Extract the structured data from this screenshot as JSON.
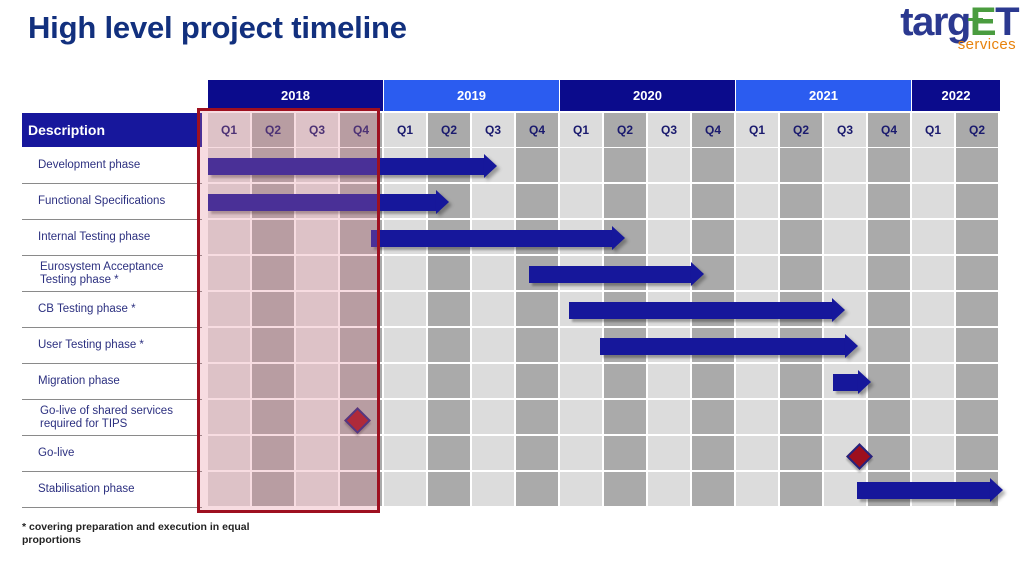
{
  "title": "High level project timeline",
  "logo": {
    "word_before": "targ",
    "word_euro": "E",
    "word_after": "T",
    "subtitle": "services"
  },
  "table": {
    "description_header": "Description",
    "years": [
      {
        "label": "2018",
        "quarters": 4,
        "tone": "dark"
      },
      {
        "label": "2019",
        "quarters": 4,
        "tone": "light"
      },
      {
        "label": "2020",
        "quarters": 4,
        "tone": "dark"
      },
      {
        "label": "2021",
        "quarters": 4,
        "tone": "light"
      },
      {
        "label": "2022",
        "quarters": 2,
        "tone": "dark"
      }
    ],
    "quarter_labels": [
      "Q1",
      "Q2",
      "Q3",
      "Q4",
      "Q1",
      "Q2",
      "Q3",
      "Q4",
      "Q1",
      "Q2",
      "Q3",
      "Q4",
      "Q1",
      "Q2",
      "Q3",
      "Q4",
      "Q1",
      "Q2"
    ],
    "rows": [
      {
        "label": "Development phase",
        "type": "bar",
        "start_q": 0.0,
        "end_q": 6.3
      },
      {
        "label": "Functional Specifications",
        "type": "bar",
        "start_q": 0.0,
        "end_q": 5.2
      },
      {
        "label": "Internal Testing phase",
        "type": "bar",
        "start_q": 3.7,
        "end_q": 9.2
      },
      {
        "label": "Eurosystem Acceptance Testing phase *",
        "type": "bar",
        "start_q": 7.3,
        "end_q": 11.0
      },
      {
        "label": "CB Testing phase *",
        "type": "bar",
        "start_q": 8.2,
        "end_q": 14.2
      },
      {
        "label": "User Testing phase *",
        "type": "bar",
        "start_q": 8.9,
        "end_q": 14.5
      },
      {
        "label": "Migration phase",
        "type": "bar",
        "start_q": 14.2,
        "end_q": 14.8
      },
      {
        "label": "Go-live of shared services required for TIPS",
        "type": "milestone",
        "at_q": 3.35
      },
      {
        "label": "Go-live",
        "type": "milestone",
        "at_q": 14.77
      },
      {
        "label": "Stabilisation phase",
        "type": "bar",
        "start_q": 14.75,
        "end_q": 17.8
      }
    ]
  },
  "footnote": "* covering preparation and execution in equal proportions",
  "colors": {
    "title": "#12307e",
    "year_dark": "#0b0b8c",
    "year_light": "#2b5cf0",
    "bar": "#16179b",
    "milestone": "#9e0f1e",
    "highlight": "#9e1020",
    "logo_blue": "#2b3990",
    "logo_green": "#4a9c3f",
    "logo_orange": "#e8820c"
  }
}
